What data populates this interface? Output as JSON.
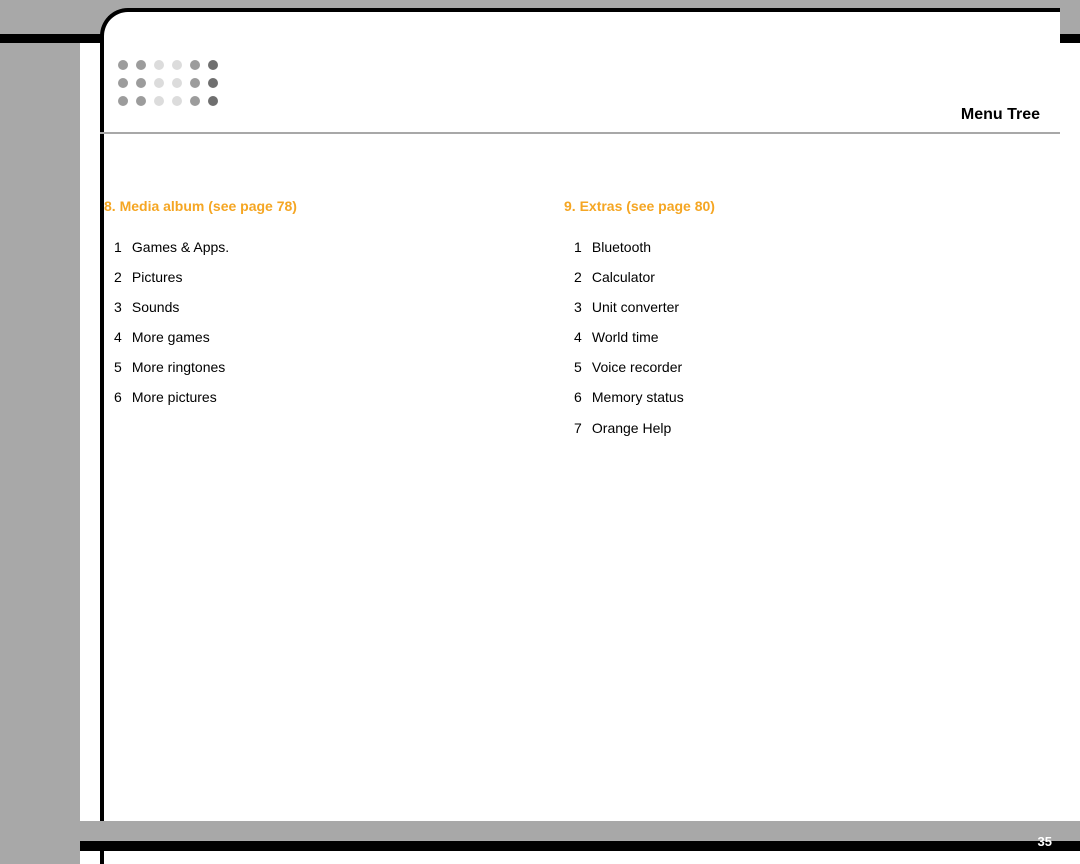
{
  "header": {
    "title": "Menu Tree",
    "page_number": "35"
  },
  "sections": [
    {
      "heading": "8. Media album (see page 78)",
      "items": [
        "Games & Apps.",
        "Pictures",
        "Sounds",
        "More games",
        "More ringtones",
        "More pictures"
      ]
    },
    {
      "heading": "9. Extras (see page 80)",
      "items": [
        "Bluetooth",
        "Calculator",
        "Unit converter",
        "World time",
        "Voice recorder",
        "Memory status",
        "Orange Help"
      ]
    }
  ]
}
